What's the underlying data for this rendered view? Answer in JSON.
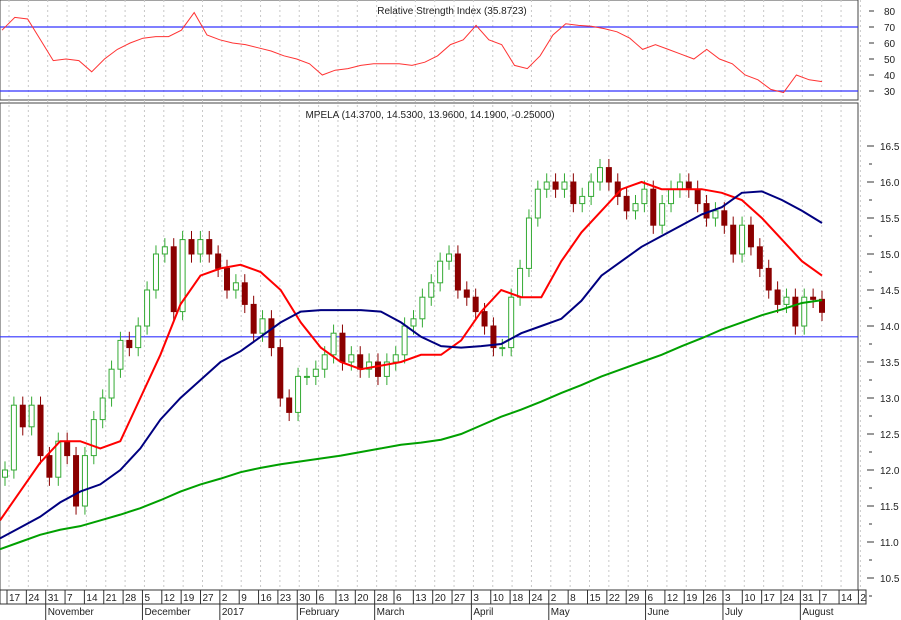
{
  "chart_data": {
    "type": "candlestick",
    "rsi_panel": {
      "title": "Relative Strength Index (35.8723)",
      "ylim": [
        20,
        85
      ],
      "yticks": [
        "80",
        "70",
        "60",
        "50",
        "40",
        "30"
      ],
      "ytick_values": [
        80,
        70,
        60,
        50,
        40,
        30
      ],
      "levels": [
        70,
        30
      ],
      "values": [
        68,
        76,
        75,
        62,
        49,
        50,
        49,
        42,
        50,
        56,
        60,
        63,
        64,
        64,
        68,
        79,
        65,
        62,
        60,
        59,
        57,
        55,
        52,
        50,
        47,
        40,
        43,
        44,
        46,
        47,
        47,
        47,
        46,
        48,
        52,
        59,
        62,
        71,
        62,
        59,
        46,
        44,
        52,
        65,
        72,
        71,
        70.5,
        69,
        67,
        63,
        56,
        59,
        56,
        53,
        50,
        56,
        50,
        47,
        40,
        37,
        31,
        29,
        40,
        37,
        35.87
      ]
    },
    "price_panel": {
      "title": "MPELA (14.3700, 14.5300, 13.9600, 14.1900, -0.25000)",
      "ylim": [
        10.3,
        16.8
      ],
      "yticks": [
        "16.5",
        "16.0",
        "15.5",
        "15.0",
        "14.5",
        "14.0",
        "13.5",
        "13.0",
        "12.5",
        "12.0",
        "11.5",
        "11.0",
        "10.5"
      ],
      "ytick_values": [
        16.5,
        16.0,
        15.5,
        15.0,
        14.5,
        14.0,
        13.5,
        13.0,
        12.5,
        12.0,
        11.5,
        11.0,
        10.5
      ],
      "horizontal_line": 13.85,
      "closes": [
        12.0,
        12.9,
        12.6,
        12.9,
        12.2,
        11.9,
        12.4,
        12.2,
        11.5,
        12.2,
        12.7,
        13.0,
        13.4,
        13.8,
        13.7,
        14.0,
        14.5,
        15.0,
        15.1,
        14.2,
        15.2,
        15.0,
        15.2,
        15.0,
        14.8,
        14.5,
        14.6,
        14.3,
        13.9,
        14.1,
        13.7,
        13.0,
        12.8,
        13.3,
        13.3,
        13.4,
        13.6,
        13.9,
        13.5,
        13.6,
        13.4,
        13.5,
        13.3,
        13.5,
        13.6,
        14.0,
        14.1,
        14.4,
        14.6,
        14.9,
        15.0,
        14.5,
        14.4,
        14.2,
        14.0,
        13.7,
        13.7,
        14.4,
        14.8,
        15.5,
        15.9,
        16.0,
        15.9,
        16.0,
        15.7,
        15.8,
        16.0,
        16.2,
        16.0,
        15.8,
        15.6,
        15.7,
        15.9,
        15.4,
        15.7,
        15.9,
        16.0,
        15.9,
        15.7,
        15.5,
        15.6,
        15.4,
        15.0,
        15.4,
        15.1,
        14.8,
        14.5,
        14.3,
        14.4,
        14.0,
        14.4,
        14.37,
        14.19
      ],
      "series": [
        {
          "name": "MA short",
          "color": "#ff0000",
          "values": [
            11.3,
            11.7,
            12.1,
            12.4,
            12.4,
            12.3,
            12.4,
            13.0,
            13.6,
            14.3,
            14.7,
            14.8,
            14.85,
            14.75,
            14.5,
            14.05,
            13.7,
            13.5,
            13.4,
            13.45,
            13.5,
            13.6,
            13.6,
            13.8,
            14.2,
            14.5,
            14.4,
            14.4,
            14.9,
            15.3,
            15.6,
            15.9,
            16.0,
            15.9,
            15.9,
            15.9,
            15.85,
            15.75,
            15.5,
            15.2,
            14.9,
            14.7
          ]
        },
        {
          "name": "MA medium",
          "color": "#000080",
          "values": [
            11.05,
            11.2,
            11.35,
            11.55,
            11.7,
            11.8,
            12.0,
            12.3,
            12.7,
            13.0,
            13.25,
            13.5,
            13.65,
            13.85,
            14.05,
            14.2,
            14.22,
            14.22,
            14.22,
            14.2,
            14.05,
            13.85,
            13.72,
            13.7,
            13.72,
            13.75,
            13.9,
            14.0,
            14.1,
            14.35,
            14.7,
            14.9,
            15.1,
            15.25,
            15.4,
            15.55,
            15.65,
            15.85,
            15.87,
            15.75,
            15.6,
            15.43
          ]
        },
        {
          "name": "MA long",
          "color": "#00a000",
          "values": [
            10.9,
            11.0,
            11.1,
            11.17,
            11.22,
            11.3,
            11.38,
            11.47,
            11.58,
            11.7,
            11.8,
            11.88,
            11.97,
            12.03,
            12.08,
            12.12,
            12.16,
            12.2,
            12.25,
            12.3,
            12.35,
            12.38,
            12.42,
            12.5,
            12.62,
            12.74,
            12.84,
            12.95,
            13.07,
            13.18,
            13.3,
            13.4,
            13.5,
            13.6,
            13.72,
            13.83,
            13.95,
            14.05,
            14.15,
            14.23,
            14.32,
            14.36
          ]
        }
      ]
    },
    "x_ticks": [
      "17",
      "24",
      "31",
      "7",
      "14",
      "21",
      "28",
      "5",
      "12",
      "19",
      "27",
      "2",
      "9",
      "16",
      "23",
      "30",
      "6",
      "13",
      "20",
      "28",
      "6",
      "13",
      "20",
      "27",
      "3",
      "10",
      "18",
      "24",
      "2",
      "8",
      "15",
      "22",
      "29",
      "6",
      "12",
      "19",
      "26",
      "3",
      "10",
      "17",
      "24",
      "31",
      "7",
      "14",
      "2"
    ],
    "months": [
      {
        "label": "November",
        "tick": 2
      },
      {
        "label": "December",
        "tick": 7
      },
      {
        "label": "2017",
        "tick": 11
      },
      {
        "label": "February",
        "tick": 15
      },
      {
        "label": "March",
        "tick": 19
      },
      {
        "label": "April",
        "tick": 24
      },
      {
        "label": "May",
        "tick": 28
      },
      {
        "label": "June",
        "tick": 33
      },
      {
        "label": "July",
        "tick": 37
      },
      {
        "label": "August",
        "tick": 41
      }
    ],
    "colors": {
      "up": "#33aa33",
      "down": "#8b0000",
      "rsi": "#ff3333",
      "level": "#3333ff"
    }
  }
}
